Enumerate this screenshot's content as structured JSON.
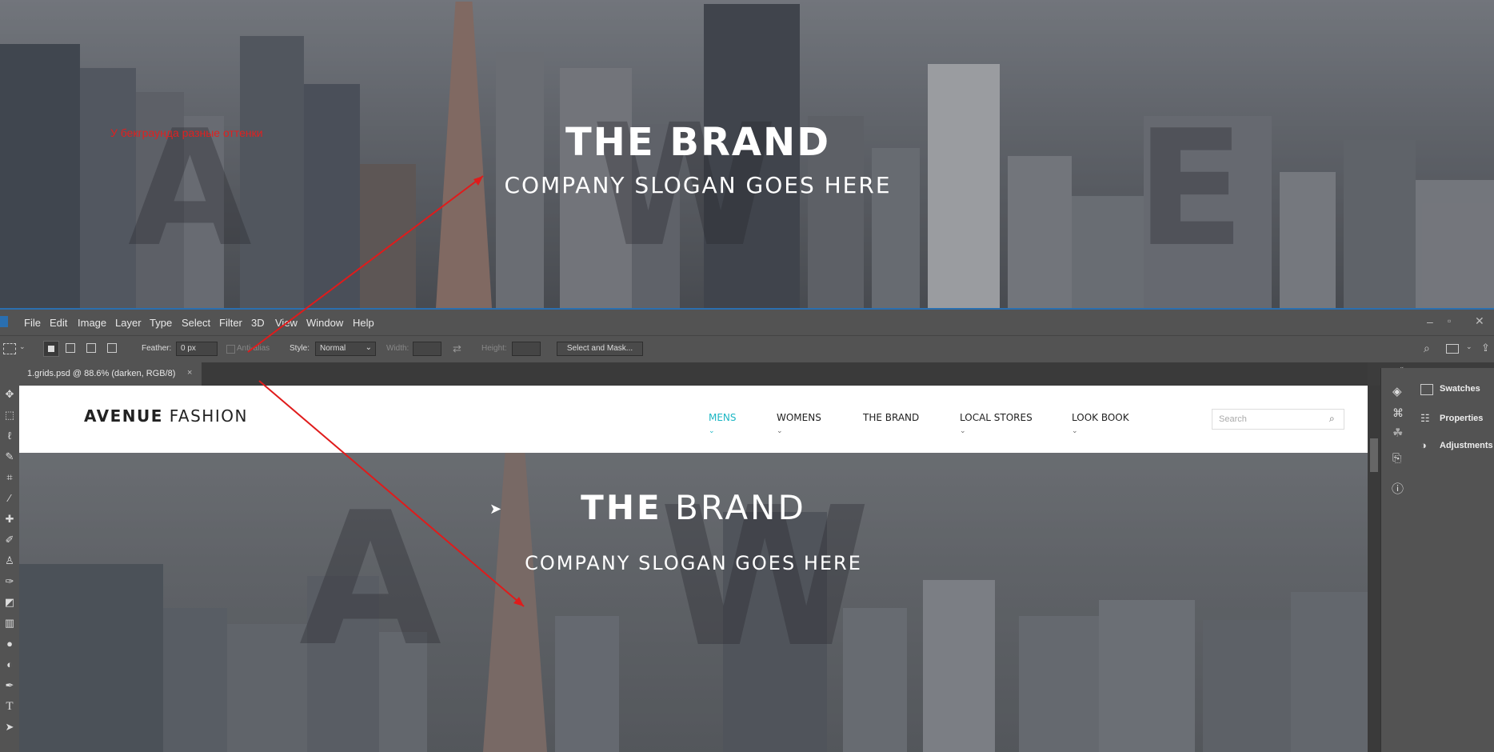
{
  "top_preview": {
    "title": "THE BRAND",
    "slogan": "COMPANY SLOGAN GOES HERE",
    "note": "У бекграунда разные оттенки"
  },
  "menubar": {
    "items": [
      "File",
      "Edit",
      "Image",
      "Layer",
      "Type",
      "Select",
      "Filter",
      "3D",
      "View",
      "Window",
      "Help"
    ]
  },
  "options": {
    "feather_label": "Feather:",
    "feather_value": "0 px",
    "antialias_label": "Anti-alias",
    "style_label": "Style:",
    "style_value": "Normal",
    "width_label": "Width:",
    "height_label": "Height:",
    "select_mask_label": "Select and Mask..."
  },
  "document_tab": {
    "label": "1.grids.psd @ 88.6% (darken, RGB/8)",
    "close": "×"
  },
  "panels": {
    "swatches": "Swatches",
    "properties": "Properties",
    "adjustments": "Adjustments"
  },
  "site": {
    "logo_bold": "AVENUE",
    "logo_light": "FASHION",
    "nav": [
      "MENS",
      "WOMENS",
      "THE BRAND",
      "LOCAL STORES",
      "LOOK BOOK"
    ],
    "search_placeholder": "Search",
    "hero_title_bold": "THE",
    "hero_title_light": "BRAND",
    "hero_slogan": "COMPANY SLOGAN GOES HERE",
    "accent_color": "#1cb7c4"
  }
}
